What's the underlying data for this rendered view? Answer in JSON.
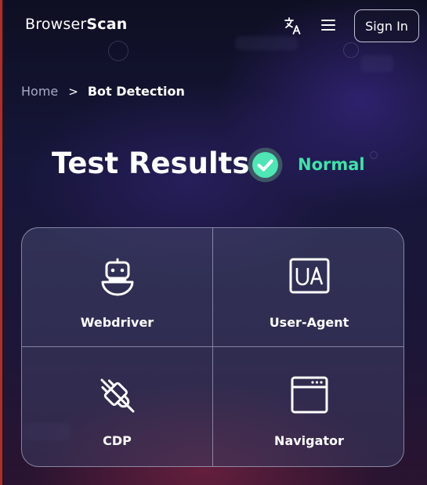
{
  "header": {
    "logo_text_regular": "Browser",
    "logo_text_bold": "Scan",
    "translate_icon": "translate-icon",
    "menu_icon": "hamburger-menu-icon",
    "signin_label": "Sign In"
  },
  "breadcrumb": {
    "home": "Home",
    "separator": ">",
    "current": "Bot Detection"
  },
  "results": {
    "title": "Test Results:",
    "status_icon": "check-circle-icon",
    "status": "Normal",
    "status_color": "#3ee3a8"
  },
  "checks": [
    {
      "label": "Webdriver",
      "icon": "robot-icon"
    },
    {
      "label": "User-Agent",
      "icon": "ua-icon"
    },
    {
      "label": "CDP",
      "icon": "plug-icon"
    },
    {
      "label": "Navigator",
      "icon": "browser-window-icon"
    }
  ]
}
